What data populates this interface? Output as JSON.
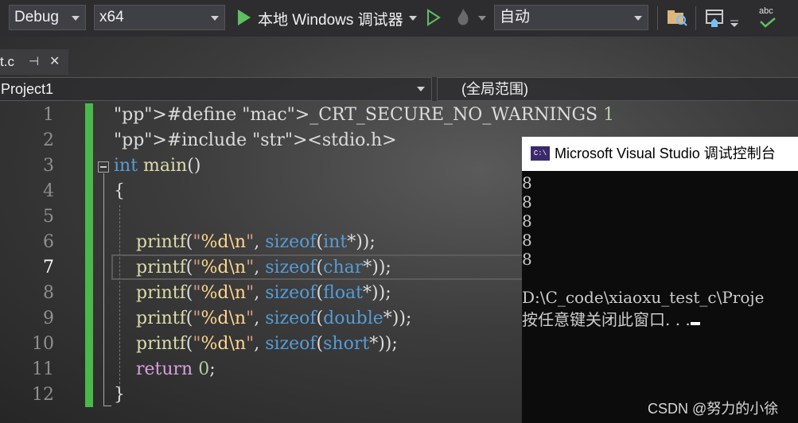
{
  "toolbar": {
    "config": "Debug",
    "platform": "x64",
    "run_label": "本地 Windows 调试器",
    "mode": "自动",
    "spell_icon_text": "abc"
  },
  "tab": {
    "file": "t.c",
    "pin": "⊣",
    "close": "✕"
  },
  "navbar": {
    "project": "Project1",
    "scope": "(全局范围)"
  },
  "editor": {
    "line_numbers": [
      "1",
      "2",
      "3",
      "4",
      "5",
      "6",
      "7",
      "8",
      "9",
      "10",
      "11",
      "12"
    ],
    "current_line": "7",
    "lines": [
      "#define _CRT_SECURE_NO_WARNINGS 1",
      "#include <stdio.h>",
      "int main()",
      "{",
      "",
      "    printf(\"%d\\n\", sizeof(int*));",
      "    printf(\"%d\\n\", sizeof(char*));",
      "    printf(\"%d\\n\", sizeof(float*));",
      "    printf(\"%d\\n\", sizeof(double*));",
      "    printf(\"%d\\n\", sizeof(short*));",
      "    return 0;",
      "}"
    ]
  },
  "console": {
    "icon_text": "C:\\",
    "title": "Microsoft Visual Studio 调试控制台",
    "output": [
      "8",
      "8",
      "8",
      "8",
      "8"
    ],
    "path_line": "D:\\C_code\\xiaoxu_test_c\\Proje",
    "prompt": "按任意键关闭此窗口. . ."
  },
  "watermark": "CSDN @努力的小徐",
  "colors": {
    "gutter_green": "#4ab84a",
    "keyword": "#569cd6",
    "string": "#d69d85",
    "function": "#dcdcaa"
  }
}
